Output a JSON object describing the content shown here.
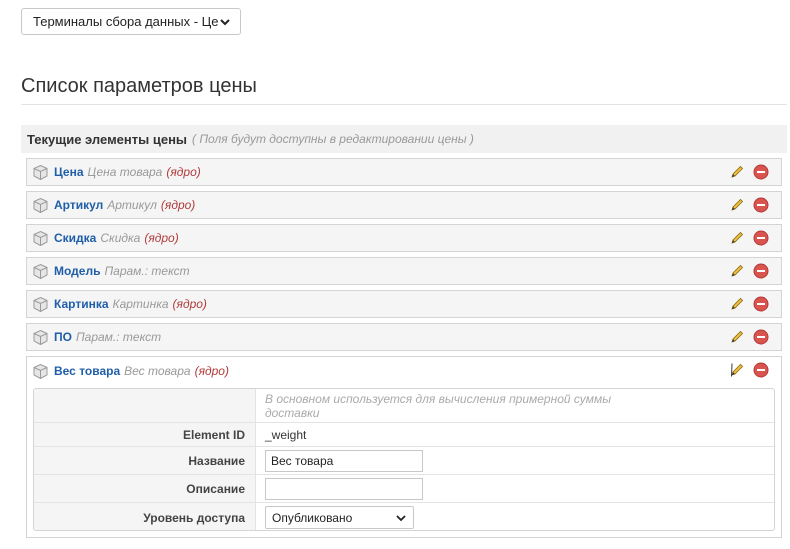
{
  "top_select": {
    "value": "Терминалы сбора данных - Цены"
  },
  "page_title": "Список параметров цены",
  "section": {
    "title": "Текущие элементы цены",
    "note": "( Поля будут доступны в редактировании цены )"
  },
  "items": [
    {
      "name": "Цена",
      "desc": "Цена товара",
      "core": "(ядро)"
    },
    {
      "name": "Артикул",
      "desc": "Артикул",
      "core": "(ядро)"
    },
    {
      "name": "Скидка",
      "desc": "Скидка",
      "core": "(ядро)"
    },
    {
      "name": "Модель",
      "desc": "Парам.: текст",
      "core": ""
    },
    {
      "name": "Картинка",
      "desc": "Картинка",
      "core": "(ядро)"
    },
    {
      "name": "ПО",
      "desc": "Парам.: текст",
      "core": ""
    }
  ],
  "expanded_item": {
    "name": "Вес товара",
    "desc": "Вес товара",
    "core": "(ядро)",
    "hint": "В основном используется для вычисления примерной суммы доставки",
    "fields": {
      "element_id_label": "Element ID",
      "element_id_value": "_weight",
      "name_label": "Название",
      "name_value": "Вес товара",
      "description_label": "Описание",
      "description_value": "",
      "access_label": "Уровень доступа",
      "access_value": "Опубликовано"
    }
  },
  "colors": {
    "link_blue": "#1f5ea8",
    "core_red": "#b13b3b",
    "delete_red": "#d9534f",
    "pencil_yellow": "#f0c040"
  },
  "icons": {
    "item": "package-icon",
    "edit": "pencil-icon",
    "delete": "delete-circle-icon",
    "dropdown": "chevron-down-icon"
  }
}
